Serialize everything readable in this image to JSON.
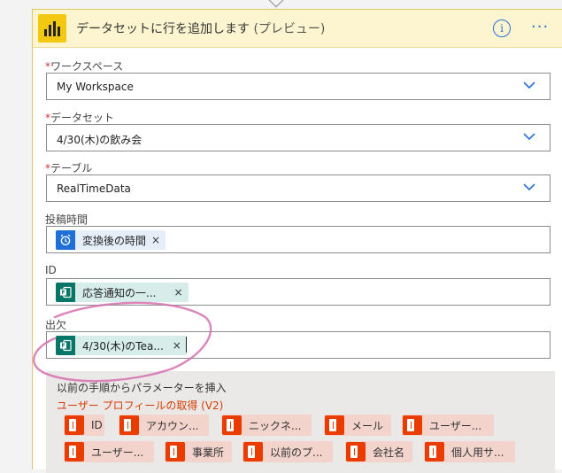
{
  "header": {
    "title": "データセットに行を追加します",
    "preview": " (プレビュー)"
  },
  "fields": {
    "workspace": {
      "label": "ワークスペース",
      "value": "My Workspace"
    },
    "dataset": {
      "label": "データセット",
      "value": "4/30(木)の飲み会"
    },
    "table": {
      "label": "テーブル",
      "value": "RealTimeData"
    },
    "posttime": {
      "label": "投稿時間",
      "token": "変換後の時間",
      "remove": "×"
    },
    "id": {
      "label": "ID",
      "token": "応答通知の一...",
      "remove": "×"
    },
    "attend": {
      "label": "出欠",
      "token": "4/30(木)のTea...",
      "remove": "×"
    }
  },
  "required_mark": "*",
  "panel": {
    "title": "以前の手順からパラメーターを挿入",
    "subtitle": "ユーザー プロフィールの取得 (V2)",
    "chips": [
      {
        "label": "ID"
      },
      {
        "label": "アカウン..."
      },
      {
        "label": "ニックネ..."
      },
      {
        "label": "メール"
      },
      {
        "label": "ユーザー..."
      },
      {
        "label": "ユーザー..."
      },
      {
        "label": "事業所"
      },
      {
        "label": "以前のプ..."
      },
      {
        "label": "会社名"
      },
      {
        "label": "個人用サ..."
      }
    ]
  },
  "icons": [
    "powerbi-logo-icon",
    "info-icon",
    "more-icon",
    "chevron-down-icon",
    "alarm-clock-icon",
    "forms-icon",
    "office-icon"
  ],
  "colors": {
    "header_bg": "#fdf5d0",
    "accent": "#2a6fd6",
    "required": "#d13438",
    "office": "#eb3c00",
    "forms": "#077568"
  }
}
